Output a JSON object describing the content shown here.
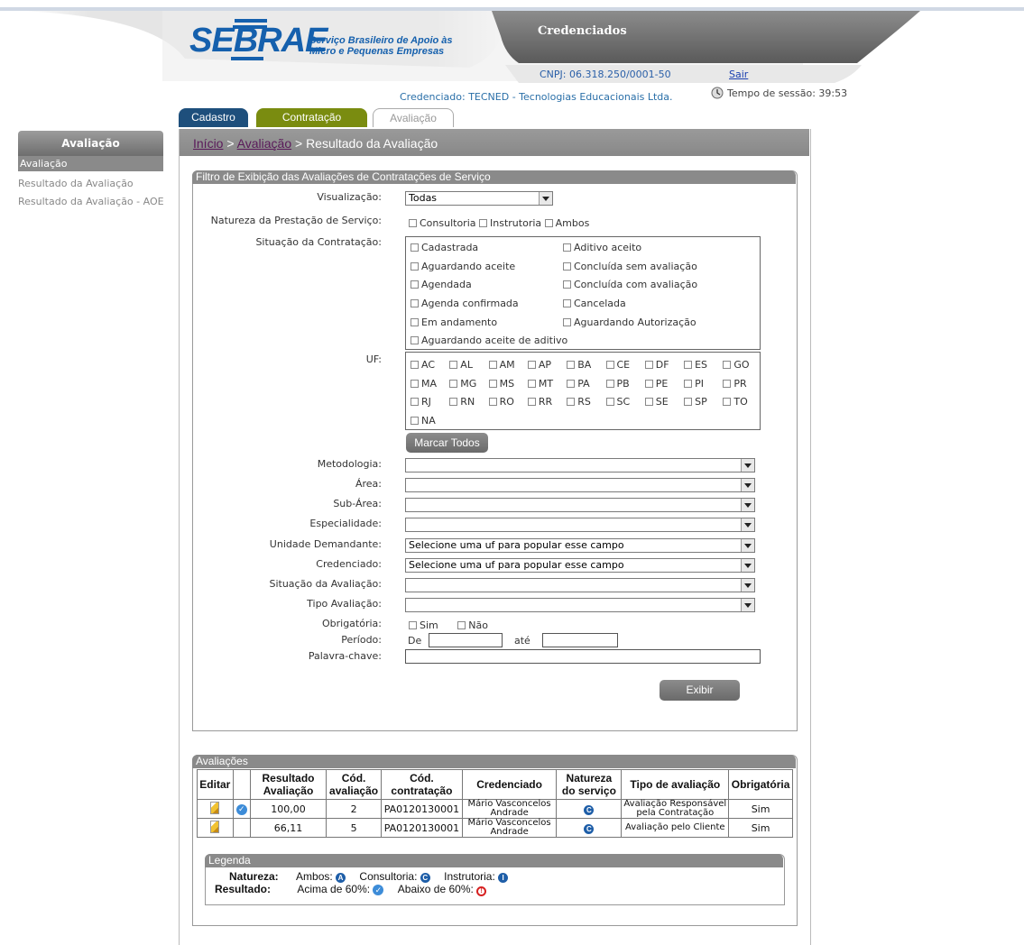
{
  "header": {
    "logo_text": "SEBRAE",
    "logo_sub1": "Serviço Brasileiro de Apoio às",
    "logo_sub2": "Micro e Pequenas Empresas",
    "title": "Credenciados",
    "cnpj": "CNPJ: 06.318.250/0001-50",
    "sair": "Sair",
    "credenciado": "Credenciado: TECNED - Tecnologias Educacionais Ltda.",
    "sessao": "Tempo de sessão: 39:53"
  },
  "tabs": [
    {
      "label": "Cadastro"
    },
    {
      "label": "Contratação"
    },
    {
      "label": "Avaliação"
    }
  ],
  "sidebar": {
    "title": "Avaliação",
    "items": [
      {
        "label": "Avaliação"
      },
      {
        "label": "Resultado da Avaliação"
      },
      {
        "label": "Resultado da Avaliação - AOE"
      }
    ]
  },
  "breadcrumb": {
    "inicio": "Início",
    "sep1": " > ",
    "avaliacao": "Avaliação",
    "sep2": " > Resultado da Avaliação"
  },
  "filter": {
    "title": "Filtro de Exibição das Avaliações de Contratações de Serviço",
    "visualizacao_label": "Visualização:",
    "visualizacao_value": "Todas",
    "natureza_label": "Natureza da Prestação de Serviço:",
    "natureza_options": [
      "Consultoria",
      "Instrutoria",
      "Ambos"
    ],
    "situacao_label": "Situação da Contratação:",
    "situacao_left": [
      "Cadastrada",
      "Aguardando aceite",
      "Agendada",
      "Agenda confirmada",
      "Em andamento",
      "Aguardando aceite de aditivo"
    ],
    "situacao_right": [
      "Aditivo aceito",
      "Concluída sem avaliação",
      "Concluída com avaliação",
      "Cancelada",
      "Aguardando Autorização"
    ],
    "uf_label": "UF:",
    "ufs": [
      "AC",
      "AL",
      "AM",
      "AP",
      "BA",
      "CE",
      "DF",
      "ES",
      "GO",
      "MA",
      "MG",
      "MS",
      "MT",
      "PA",
      "PB",
      "PE",
      "PI",
      "PR",
      "RJ",
      "RN",
      "RO",
      "RR",
      "RS",
      "SC",
      "SE",
      "SP",
      "TO",
      "NA"
    ],
    "marcar_todos": "Marcar Todos",
    "metodologia_label": "Metodologia:",
    "area_label": "Área:",
    "subarea_label": "Sub-Área:",
    "especialidade_label": "Especialidade:",
    "unidade_label": "Unidade Demandante:",
    "unidade_value": "Selecione uma uf para popular esse campo",
    "credenciado_label": "Credenciado:",
    "credenciado_value": "Selecione uma uf para popular esse campo",
    "situacao_aval_label": "Situação da Avaliação:",
    "tipo_label": "Tipo Avaliação:",
    "obrigatoria_label": "Obrigatória:",
    "obrigatoria_sim": "Sim",
    "obrigatoria_nao": "Não",
    "periodo_label": "Período:",
    "periodo_de": "De",
    "periodo_ate": "até",
    "palavra_label": "Palavra-chave:",
    "exibir": "Exibir"
  },
  "results": {
    "title": "Avaliações",
    "headers": [
      "Editar",
      "",
      "Resultado Avaliação",
      "Cód. avaliação",
      "Cód. contratação",
      "Credenciado",
      "Natureza do serviço",
      "Tipo de avaliação",
      "Obrigatória"
    ],
    "rows": [
      {
        "resultado": "100,00",
        "cod_aval": "2",
        "cod_contr": "PA0120130001",
        "credenciado": "Mário Vasconcelos Andrade",
        "natureza": "C",
        "tipo": "Avaliação Responsável pela Contratação",
        "obrigatoria": "Sim",
        "check": true
      },
      {
        "resultado": "66,11",
        "cod_aval": "5",
        "cod_contr": "PA0120130001",
        "credenciado": "Mário Vasconcelos Andrade",
        "natureza": "C",
        "tipo": "Avaliação pelo Cliente",
        "obrigatoria": "Sim",
        "check": false
      }
    ]
  },
  "legend": {
    "title": "Legenda",
    "natureza_label": "Natureza:",
    "ambos": "Ambos:",
    "consultoria": "Consultoria:",
    "instrutoria": "Instrutoria:",
    "resultado_label": "Resultado:",
    "acima": "Acima de 60%:",
    "abaixo": "Abaixo de 60%:",
    "badge_a": "A",
    "badge_c": "C",
    "badge_i": "I"
  },
  "colors": {
    "tab_cadastro": "#1e4f7c",
    "tab_contratacao": "#7a8c10",
    "brand": "#1560ad"
  }
}
